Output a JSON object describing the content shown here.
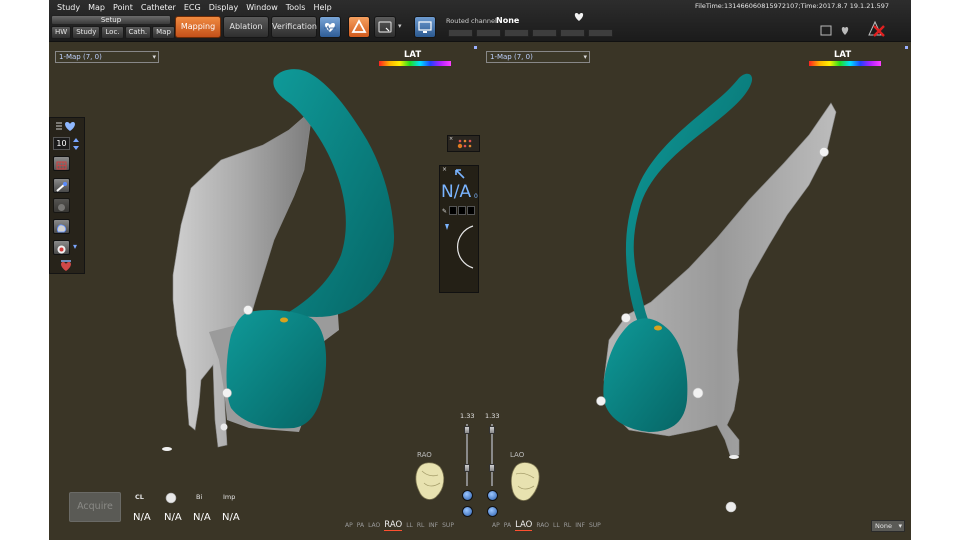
{
  "menu": [
    "Study",
    "Map",
    "Point",
    "Catheter",
    "ECG",
    "Display",
    "Window",
    "Tools",
    "Help"
  ],
  "setup": {
    "label": "Setup",
    "buttons": [
      "HW",
      "Study",
      "Loc.",
      "Cath.",
      "Map"
    ]
  },
  "modes": {
    "mapping": "Mapping",
    "ablation": "Ablation",
    "verification": "Verification"
  },
  "routed_channel": {
    "label": "Routed channel",
    "value": "None"
  },
  "file_time": "FileTime:13146606081​5972107;Time:2017.8.7 19.1.21.597",
  "left_map": {
    "selector": "1-Map (7, 0)",
    "legend": "LAT"
  },
  "right_map": {
    "selector": "1-Map (7, 0)",
    "legend": "LAT"
  },
  "palette": {
    "number": "10"
  },
  "center_panel": {
    "value": "N/A",
    "sub": "0"
  },
  "acquire": "Acquire",
  "measurements": {
    "cl": {
      "label": "CL",
      "value": "N/A"
    },
    "uni": {
      "value": "N/A"
    },
    "bi": {
      "label": "Bi",
      "value": "N/A"
    },
    "imp": {
      "label": "Imp",
      "value": "N/A"
    }
  },
  "zoom": {
    "left": "1.33",
    "right": "1.33"
  },
  "orientation": {
    "left_tag": "RAO",
    "right_tag": "LAO",
    "left_views": [
      "AP",
      "PA",
      "LAO",
      "RAO",
      "LL",
      "RL",
      "INF",
      "SUP"
    ],
    "left_active": "RAO",
    "right_views": [
      "AP",
      "PA",
      "LAO",
      "RAO",
      "LL",
      "RL",
      "INF",
      "SUP"
    ],
    "right_active": "LAO"
  },
  "bottom_select": "None",
  "colors": {
    "background": "#3a3526",
    "tissue": "#a6a6a6",
    "teal": "#0a7f80",
    "accent_orange": "#e06a28",
    "na_blue": "#7ab4ff"
  },
  "icons": {
    "heart_button": "heart-map-icon",
    "triangle_button": "triangle-tool-icon",
    "camera_button": "snapshot-icon",
    "monitor_button": "monitor-icon"
  }
}
